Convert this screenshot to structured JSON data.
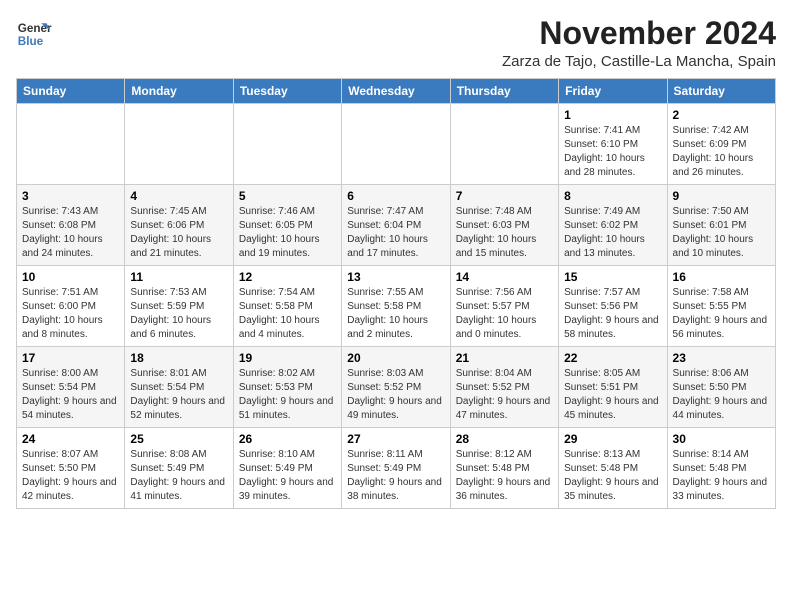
{
  "logo": {
    "line1": "General",
    "line2": "Blue"
  },
  "title": "November 2024",
  "location": "Zarza de Tajo, Castille-La Mancha, Spain",
  "days_of_week": [
    "Sunday",
    "Monday",
    "Tuesday",
    "Wednesday",
    "Thursday",
    "Friday",
    "Saturday"
  ],
  "weeks": [
    [
      {
        "day": "",
        "info": ""
      },
      {
        "day": "",
        "info": ""
      },
      {
        "day": "",
        "info": ""
      },
      {
        "day": "",
        "info": ""
      },
      {
        "day": "",
        "info": ""
      },
      {
        "day": "1",
        "info": "Sunrise: 7:41 AM\nSunset: 6:10 PM\nDaylight: 10 hours and 28 minutes."
      },
      {
        "day": "2",
        "info": "Sunrise: 7:42 AM\nSunset: 6:09 PM\nDaylight: 10 hours and 26 minutes."
      }
    ],
    [
      {
        "day": "3",
        "info": "Sunrise: 7:43 AM\nSunset: 6:08 PM\nDaylight: 10 hours and 24 minutes."
      },
      {
        "day": "4",
        "info": "Sunrise: 7:45 AM\nSunset: 6:06 PM\nDaylight: 10 hours and 21 minutes."
      },
      {
        "day": "5",
        "info": "Sunrise: 7:46 AM\nSunset: 6:05 PM\nDaylight: 10 hours and 19 minutes."
      },
      {
        "day": "6",
        "info": "Sunrise: 7:47 AM\nSunset: 6:04 PM\nDaylight: 10 hours and 17 minutes."
      },
      {
        "day": "7",
        "info": "Sunrise: 7:48 AM\nSunset: 6:03 PM\nDaylight: 10 hours and 15 minutes."
      },
      {
        "day": "8",
        "info": "Sunrise: 7:49 AM\nSunset: 6:02 PM\nDaylight: 10 hours and 13 minutes."
      },
      {
        "day": "9",
        "info": "Sunrise: 7:50 AM\nSunset: 6:01 PM\nDaylight: 10 hours and 10 minutes."
      }
    ],
    [
      {
        "day": "10",
        "info": "Sunrise: 7:51 AM\nSunset: 6:00 PM\nDaylight: 10 hours and 8 minutes."
      },
      {
        "day": "11",
        "info": "Sunrise: 7:53 AM\nSunset: 5:59 PM\nDaylight: 10 hours and 6 minutes."
      },
      {
        "day": "12",
        "info": "Sunrise: 7:54 AM\nSunset: 5:58 PM\nDaylight: 10 hours and 4 minutes."
      },
      {
        "day": "13",
        "info": "Sunrise: 7:55 AM\nSunset: 5:58 PM\nDaylight: 10 hours and 2 minutes."
      },
      {
        "day": "14",
        "info": "Sunrise: 7:56 AM\nSunset: 5:57 PM\nDaylight: 10 hours and 0 minutes."
      },
      {
        "day": "15",
        "info": "Sunrise: 7:57 AM\nSunset: 5:56 PM\nDaylight: 9 hours and 58 minutes."
      },
      {
        "day": "16",
        "info": "Sunrise: 7:58 AM\nSunset: 5:55 PM\nDaylight: 9 hours and 56 minutes."
      }
    ],
    [
      {
        "day": "17",
        "info": "Sunrise: 8:00 AM\nSunset: 5:54 PM\nDaylight: 9 hours and 54 minutes."
      },
      {
        "day": "18",
        "info": "Sunrise: 8:01 AM\nSunset: 5:54 PM\nDaylight: 9 hours and 52 minutes."
      },
      {
        "day": "19",
        "info": "Sunrise: 8:02 AM\nSunset: 5:53 PM\nDaylight: 9 hours and 51 minutes."
      },
      {
        "day": "20",
        "info": "Sunrise: 8:03 AM\nSunset: 5:52 PM\nDaylight: 9 hours and 49 minutes."
      },
      {
        "day": "21",
        "info": "Sunrise: 8:04 AM\nSunset: 5:52 PM\nDaylight: 9 hours and 47 minutes."
      },
      {
        "day": "22",
        "info": "Sunrise: 8:05 AM\nSunset: 5:51 PM\nDaylight: 9 hours and 45 minutes."
      },
      {
        "day": "23",
        "info": "Sunrise: 8:06 AM\nSunset: 5:50 PM\nDaylight: 9 hours and 44 minutes."
      }
    ],
    [
      {
        "day": "24",
        "info": "Sunrise: 8:07 AM\nSunset: 5:50 PM\nDaylight: 9 hours and 42 minutes."
      },
      {
        "day": "25",
        "info": "Sunrise: 8:08 AM\nSunset: 5:49 PM\nDaylight: 9 hours and 41 minutes."
      },
      {
        "day": "26",
        "info": "Sunrise: 8:10 AM\nSunset: 5:49 PM\nDaylight: 9 hours and 39 minutes."
      },
      {
        "day": "27",
        "info": "Sunrise: 8:11 AM\nSunset: 5:49 PM\nDaylight: 9 hours and 38 minutes."
      },
      {
        "day": "28",
        "info": "Sunrise: 8:12 AM\nSunset: 5:48 PM\nDaylight: 9 hours and 36 minutes."
      },
      {
        "day": "29",
        "info": "Sunrise: 8:13 AM\nSunset: 5:48 PM\nDaylight: 9 hours and 35 minutes."
      },
      {
        "day": "30",
        "info": "Sunrise: 8:14 AM\nSunset: 5:48 PM\nDaylight: 9 hours and 33 minutes."
      }
    ]
  ]
}
